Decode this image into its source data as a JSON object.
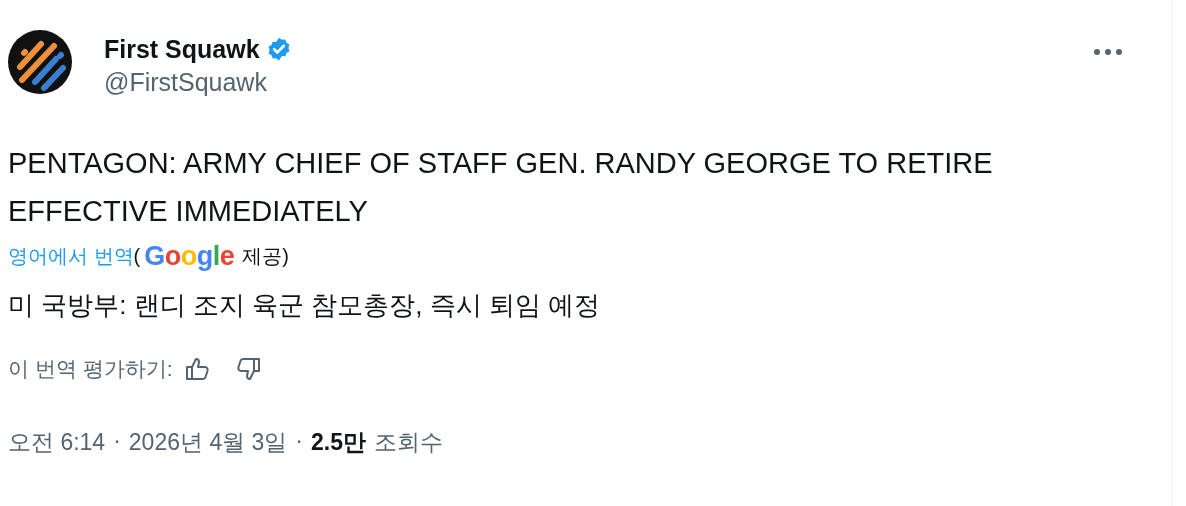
{
  "author": {
    "name": "First Squawk",
    "verified": true,
    "handle": "@FirstSquawk"
  },
  "post": {
    "text": "PENTAGON: ARMY CHIEF OF STAFF GEN. RANDY GEORGE TO RETIRE EFFECTIVE IMMEDIATELY"
  },
  "translation": {
    "link": "영어에서 번역",
    "open_paren": "(",
    "provider": "Google",
    "provided": "제공)",
    "text": "미 국방부: 랜디 조지 육군 참모총장, 즉시 퇴임 예정",
    "rate_label": "이 번역 평가하기:"
  },
  "meta": {
    "time": "오전 6:14",
    "separator_1": "·",
    "date": "2026년 4월 3일",
    "separator_2": "·",
    "views_count": "2.5만",
    "views_label": "조회수"
  }
}
